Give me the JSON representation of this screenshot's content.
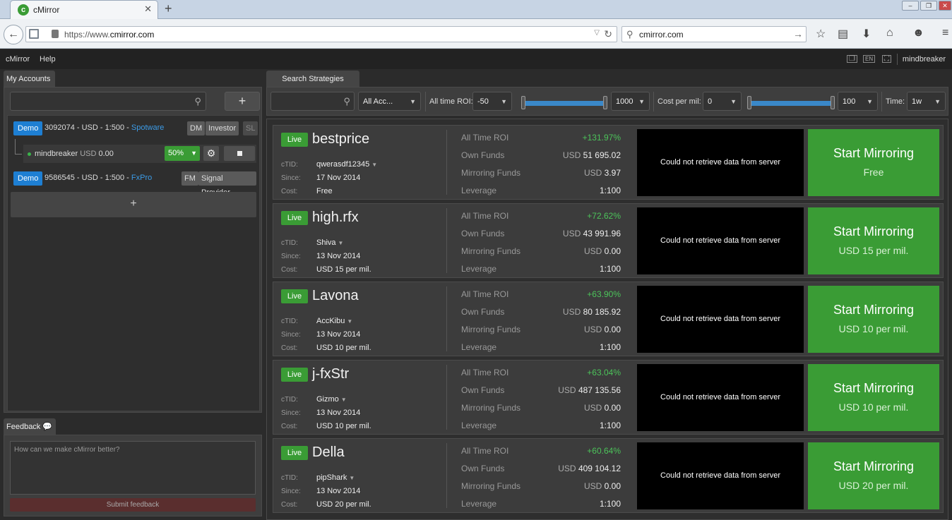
{
  "browser": {
    "tab_title": "cMirror",
    "tab_close": "✕",
    "new_tab": "+",
    "url_prefix": "https://www.",
    "url_domain": "cmirror.com",
    "search_text": "cmirror.com"
  },
  "header": {
    "menu": [
      "cMirror",
      "Help"
    ],
    "lang": "EN",
    "username": "mindbreaker"
  },
  "left": {
    "tab": "My Accounts",
    "add": "+",
    "accounts": [
      {
        "badge": "Demo",
        "text": "3092074 - USD - 1:500 - ",
        "broker": "Spotware",
        "chips": [
          "DM",
          "Investor",
          "SL"
        ]
      },
      {
        "badge": "Demo",
        "text": "9586545 - USD - 1:500 - ",
        "broker": "FxPro",
        "chips": [
          "FM",
          "Signal Provider"
        ]
      }
    ],
    "sub_account": {
      "name": "mindbreaker",
      "currency": "USD",
      "amount": "0.00",
      "percent": "50%"
    },
    "add_account": "+"
  },
  "feedback": {
    "tab": "Feedback",
    "placeholder": "How can we make cMirror better?",
    "submit": "Submit feedback"
  },
  "filters": {
    "tab": "Search Strategies",
    "account_select": "All Acc...",
    "roi_label": "All time ROI:",
    "roi_min": "-50",
    "roi_max": "1000",
    "cost_label": "Cost per mil:",
    "cost_min": "0",
    "cost_max": "100",
    "time_label": "Time:",
    "time_value": "1w"
  },
  "labels": {
    "live": "Live",
    "ctid": "cTID:",
    "since": "Since:",
    "cost": "Cost:",
    "roi": "All Time ROI",
    "own": "Own Funds",
    "mirroring": "Mirroring Funds",
    "leverage": "Leverage",
    "chart_error": "Could not retrieve data from server",
    "start": "Start Mirroring"
  },
  "strategies": [
    {
      "name": "bestprice",
      "ctid": "qwerasdf12345",
      "since": "17 Nov 2014",
      "cost": "Free",
      "roi": "+131.97%",
      "own_cur": "USD",
      "own": "51 695.02",
      "mir_cur": "USD",
      "mir": "3.97",
      "leverage": "1:100",
      "btn_cost": "Free"
    },
    {
      "name": "high.rfx",
      "ctid": "Shiva",
      "since": "13 Nov 2014",
      "cost": "USD 15 per mil.",
      "roi": "+72.62%",
      "own_cur": "USD",
      "own": "43 991.96",
      "mir_cur": "USD",
      "mir": "0.00",
      "leverage": "1:100",
      "btn_cost": "USD 15 per mil."
    },
    {
      "name": "Lavona",
      "ctid": "AccKibu",
      "since": "13 Nov 2014",
      "cost": "USD 10 per mil.",
      "roi": "+63.90%",
      "own_cur": "USD",
      "own": "80 185.92",
      "mir_cur": "USD",
      "mir": "0.00",
      "leverage": "1:100",
      "btn_cost": "USD 10 per mil."
    },
    {
      "name": "j-fxStr",
      "ctid": "Gizmo",
      "since": "13 Nov 2014",
      "cost": "USD 10 per mil.",
      "roi": "+63.04%",
      "own_cur": "USD",
      "own": "487 135.56",
      "mir_cur": "USD",
      "mir": "0.00",
      "leverage": "1:100",
      "btn_cost": "USD 10 per mil."
    },
    {
      "name": "Della",
      "ctid": "pipShark",
      "since": "13 Nov 2014",
      "cost": "USD 20 per mil.",
      "roi": "+60.64%",
      "own_cur": "USD",
      "own": "409 104.12",
      "mir_cur": "USD",
      "mir": "0.00",
      "leverage": "1:100",
      "btn_cost": "USD 20 per mil."
    }
  ]
}
